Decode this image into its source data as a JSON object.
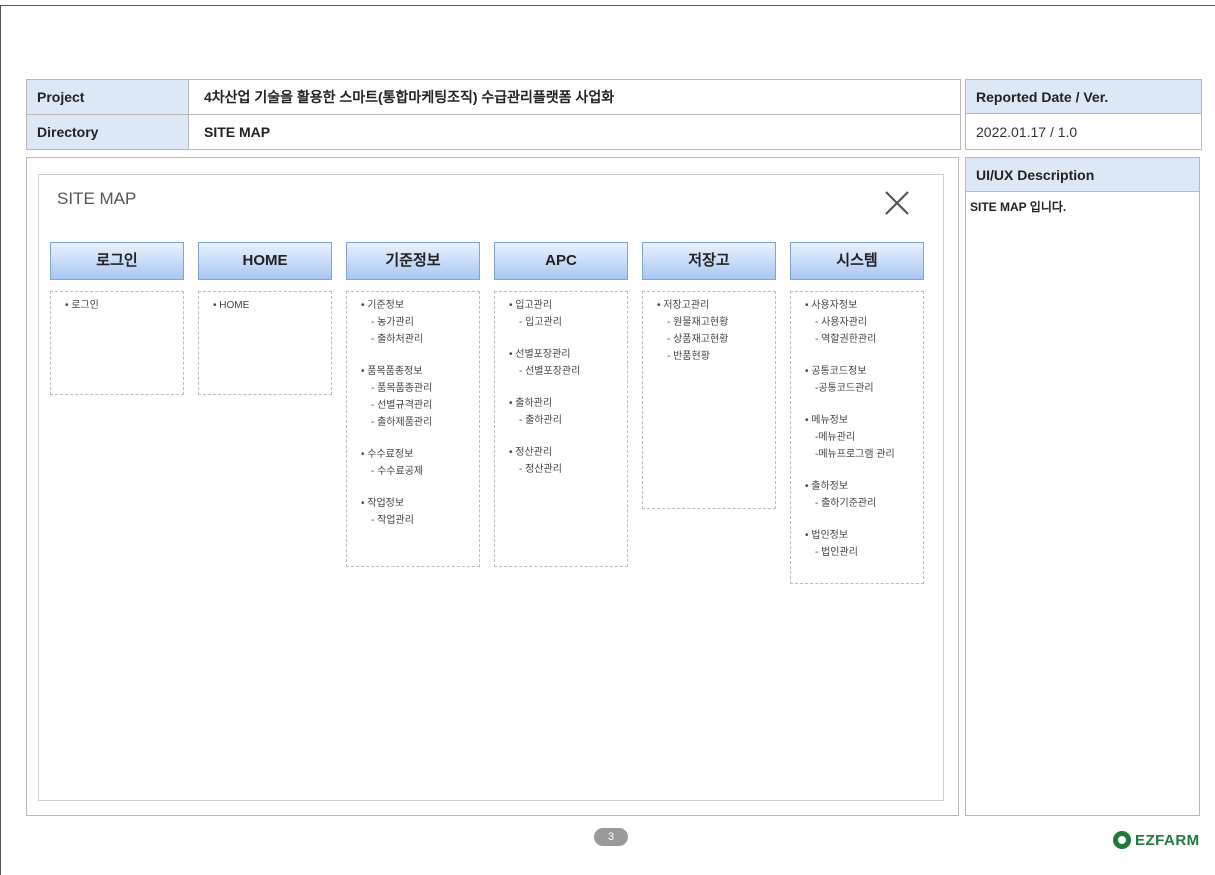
{
  "header": {
    "project_key": "Project",
    "project_value": "4차산업 기술을 활용한 스마트(통합마케팅조직) 수급관리플랫폼 사업화",
    "directory_key": "Directory",
    "directory_value": "SITE MAP"
  },
  "report": {
    "label": "Reported Date / Ver.",
    "value": "2022.01.17  /  1.0"
  },
  "sitemap": {
    "title": "SITE MAP",
    "columns": [
      {
        "title": "로그인",
        "items": [
          {
            "text": "• 로그인"
          }
        ]
      },
      {
        "title": "HOME",
        "items": [
          {
            "text": "• HOME"
          }
        ]
      },
      {
        "title": "기준정보",
        "items": [
          {
            "text": "• 기준정보"
          },
          {
            "text": "- 농가관리"
          },
          {
            "text": "- 출하처관리"
          },
          {
            "text": "• 품목품종정보"
          },
          {
            "text": "- 품목품종관리"
          },
          {
            "text": "- 선별규격관리"
          },
          {
            "text": "- 출하제품관리"
          },
          {
            "text": "• 수수료정보"
          },
          {
            "text": "- 수수료공제"
          },
          {
            "text": "• 작업정보"
          },
          {
            "text": "- 작업관리"
          }
        ]
      },
      {
        "title": "APC",
        "items": [
          {
            "text": "• 입고관리"
          },
          {
            "text": "- 입고관리"
          },
          {
            "text": "• 선별포장관리"
          },
          {
            "text": "- 선별포장관리"
          },
          {
            "text": "• 출하관리"
          },
          {
            "text": "- 출하관리"
          },
          {
            "text": "• 정산관리"
          },
          {
            "text": "- 정산관리"
          }
        ]
      },
      {
        "title": "저장고",
        "items": [
          {
            "text": "• 저장고관리"
          },
          {
            "text": "- 원물재고현황"
          },
          {
            "text": "- 상품재고현황"
          },
          {
            "text": "- 반품현황"
          }
        ]
      },
      {
        "title": "시스템",
        "items": [
          {
            "text": "• 사용자정보"
          },
          {
            "text": "- 사용자관리"
          },
          {
            "text": "- 역할권한관리"
          },
          {
            "text": "• 공통코드정보"
          },
          {
            "text": "-공통코드관리"
          },
          {
            "text": "• 메뉴정보"
          },
          {
            "text": "-메뉴관리"
          },
          {
            "text": "-메뉴프로그램 관리"
          },
          {
            "text": "• 출하정보"
          },
          {
            "text": "- 출하기준관리"
          },
          {
            "text": "• 법인정보"
          },
          {
            "text": "- 법인관리"
          }
        ]
      }
    ]
  },
  "description": {
    "label": "UI/UX Description",
    "text": "SITE MAP 입니다."
  },
  "footer": {
    "page_number": "3",
    "logo_text": "EZFARM"
  },
  "icons": {
    "close": "close-icon",
    "logo": "ezfarm-logo-icon"
  }
}
